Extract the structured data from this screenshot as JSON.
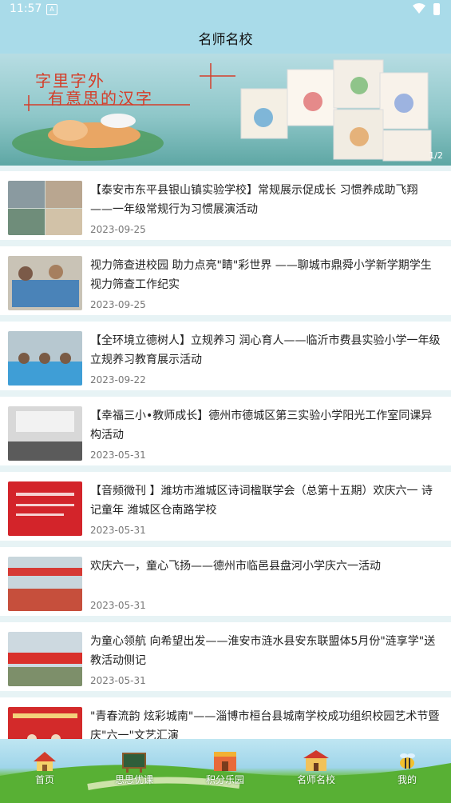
{
  "status_bar": {
    "time": "11:57"
  },
  "header": {
    "title": "名师名校"
  },
  "banner": {
    "line1": "字里字外",
    "line2": "有意思的汉字",
    "pager": "1/2"
  },
  "articles": [
    {
      "title": "【泰安市东平县银山镇实验学校】常规展示促成长 习惯养成助飞翔 ——一年级常规行为习惯展演活动",
      "date": "2023-09-25"
    },
    {
      "title": "视力筛查进校园 助力点亮\"睛\"彩世界 ——聊城市鼎舜小学新学期学生视力筛查工作纪实",
      "date": "2023-09-25"
    },
    {
      "title": "【全环境立德树人】立规养习 润心育人——临沂市费县实验小学一年级立规养习教育展示活动",
      "date": "2023-09-22"
    },
    {
      "title": "【幸福三小•教师成长】德州市德城区第三实验小学阳光工作室同课异构活动",
      "date": "2023-05-31"
    },
    {
      "title": "【音频微刊 】潍坊市潍城区诗词楹联学会（总第十五期）欢庆六一 诗记童年 潍城区仓南路学校",
      "date": "2023-05-31"
    },
    {
      "title": "欢庆六一，童心飞扬——德州市临邑县盘河小学庆六一活动",
      "date": "2023-05-31"
    },
    {
      "title": "为童心领航 向希望出发——淮安市涟水县安东联盟体5月份\"涟享学\"送教活动侧记",
      "date": "2023-05-31"
    },
    {
      "title": "\"青春流韵 炫彩城南\"——淄博市桓台县城南学校成功组织校园艺术节暨庆\"六一\"文艺汇演",
      "date": ""
    }
  ],
  "bottom_nav": [
    {
      "label": "首页",
      "icon": "home-icon"
    },
    {
      "label": "思思优课",
      "icon": "blackboard-icon"
    },
    {
      "label": "积分乐园",
      "icon": "shop-icon"
    },
    {
      "label": "名师名校",
      "icon": "school-icon"
    },
    {
      "label": "我的",
      "icon": "bee-icon"
    }
  ],
  "colors": {
    "accent": "#a9dbe9",
    "grass": "#4da52e"
  }
}
